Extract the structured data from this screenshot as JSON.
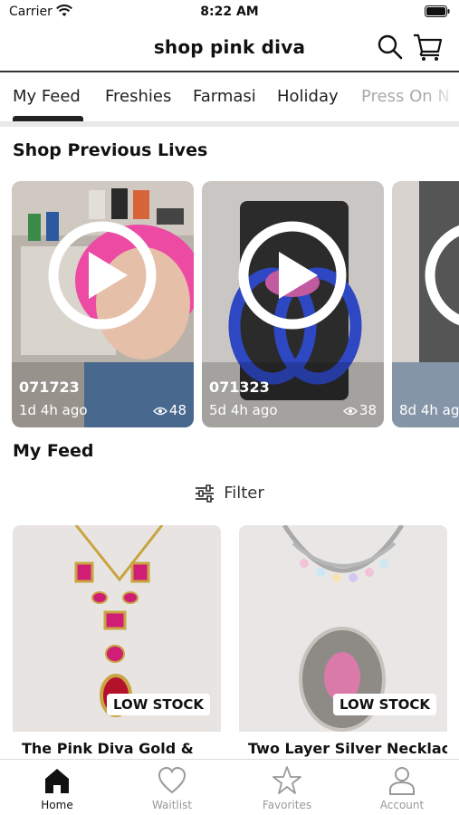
{
  "status_bar": {
    "carrier": "Carrier",
    "time": "8:22 AM"
  },
  "header": {
    "title": "shop pink diva"
  },
  "tabs": [
    {
      "label": "My Feed",
      "active": true
    },
    {
      "label": "Freshies"
    },
    {
      "label": "Farmasi"
    },
    {
      "label": "Holiday"
    },
    {
      "label": "Press On N"
    }
  ],
  "previous_lives": {
    "title": "Shop Previous Lives",
    "items": [
      {
        "code": "071723",
        "age": "1d 4h ago",
        "views": "48"
      },
      {
        "code": "071323",
        "age": "5d 4h ago",
        "views": "38"
      },
      {
        "code": "",
        "age": "8d 4h ag",
        "views": ""
      }
    ]
  },
  "feed": {
    "title": "My Feed",
    "filter_label": "Filter",
    "products": [
      {
        "name": "The Pink Diva Gold &",
        "badge": "LOW STOCK"
      },
      {
        "name": "Two Layer Silver Necklace",
        "badge": "LOW STOCK"
      }
    ]
  },
  "bottom_nav": [
    {
      "label": "Home",
      "icon": "home-icon",
      "active": true
    },
    {
      "label": "Waitlist",
      "icon": "heart-icon"
    },
    {
      "label": "Favorites",
      "icon": "star-icon"
    },
    {
      "label": "Account",
      "icon": "user-icon"
    }
  ],
  "colors": {
    "accent": "#111111",
    "badge_bg": "#ffffff",
    "inactive_nav": "#999999"
  }
}
